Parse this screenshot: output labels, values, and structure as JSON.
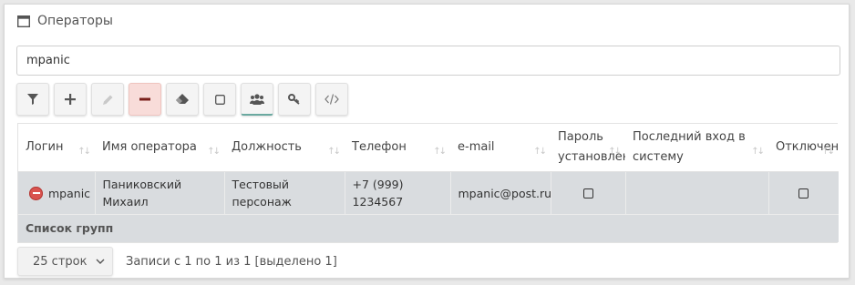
{
  "panel": {
    "title": "Операторы"
  },
  "search": {
    "value": "mpanic"
  },
  "toolbar": {
    "buttons": [
      {
        "icon": "filter-icon"
      },
      {
        "icon": "plus-icon"
      },
      {
        "icon": "pencil-icon"
      },
      {
        "icon": "minus-icon"
      },
      {
        "icon": "eraser-icon"
      },
      {
        "icon": "square-icon"
      },
      {
        "icon": "users-icon"
      },
      {
        "icon": "key-icon"
      },
      {
        "icon": "code-icon"
      }
    ]
  },
  "table": {
    "headers": [
      "Логин",
      "Имя оператора",
      "Должность",
      "Телефон",
      "e-mail",
      "Пароль установлен",
      "Последний вход в систему",
      "Отключен"
    ],
    "rows": [
      {
        "login": "mpanic",
        "name": "Паниковский Михаил",
        "position": "Тестовый персонаж",
        "phone": "+7 (999) 1234567",
        "email": "mpanic@post.ru",
        "password_set": false,
        "last_login": "",
        "disabled": false
      }
    ],
    "group_row_label": "Список групп"
  },
  "pager": {
    "page_size": "25 строк",
    "info": "Записи с 1 по 1 из 1 [выделено 1]"
  },
  "colors": {
    "danger": "#d9534f",
    "row_bg": "#d9dcdf",
    "active_underline": "#6aa9a0"
  }
}
